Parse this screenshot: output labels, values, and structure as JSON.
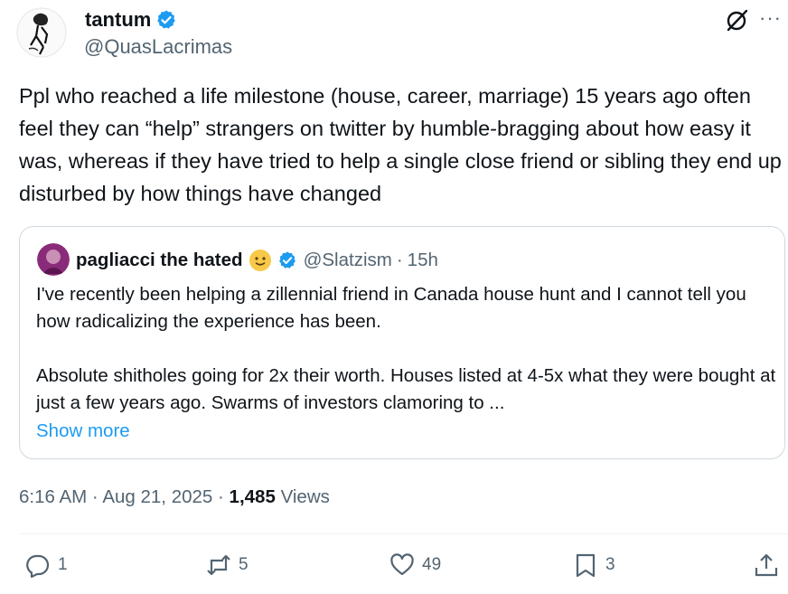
{
  "tweet": {
    "author_name": "tantum",
    "author_handle": "@QuasLacrimas",
    "text": "Ppl who reached a life milestone (house, career, marriage) 15 years ago often feel they can “help” strangers on twitter by humble-bragging about how easy it was, whereas if they have tried to help a single close friend or sibling they end up disturbed by how things have changed",
    "time": "6:16 AM",
    "date": "Aug 21, 2025",
    "views_count": "1,485",
    "views_label": "Views",
    "more_label": "···"
  },
  "quote": {
    "author_name": "pagliacci the hated",
    "author_handle": "@Slatzism",
    "age": "15h",
    "text": "I've recently been helping a zillennial friend in Canada house hunt and I cannot tell you how radicalizing the experience has been.\n\nAbsolute shitholes going for 2x their worth. Houses listed at 4-5x what they were bought at just a few years ago. Swarms of investors clamoring to ...",
    "show_more": "Show more"
  },
  "actions": {
    "replies": "1",
    "reposts": "5",
    "likes": "49",
    "bookmarks": "3"
  },
  "icons": [
    "verified-badge-icon",
    "grok-icon",
    "more-icon",
    "smiley-emoji-icon",
    "reply-icon",
    "repost-icon",
    "like-icon",
    "bookmark-icon",
    "share-icon"
  ],
  "colors": {
    "accent": "#1d9bf0",
    "secondary_text": "#536471",
    "primary_text": "#0f1419",
    "border": "#cfd9de"
  }
}
